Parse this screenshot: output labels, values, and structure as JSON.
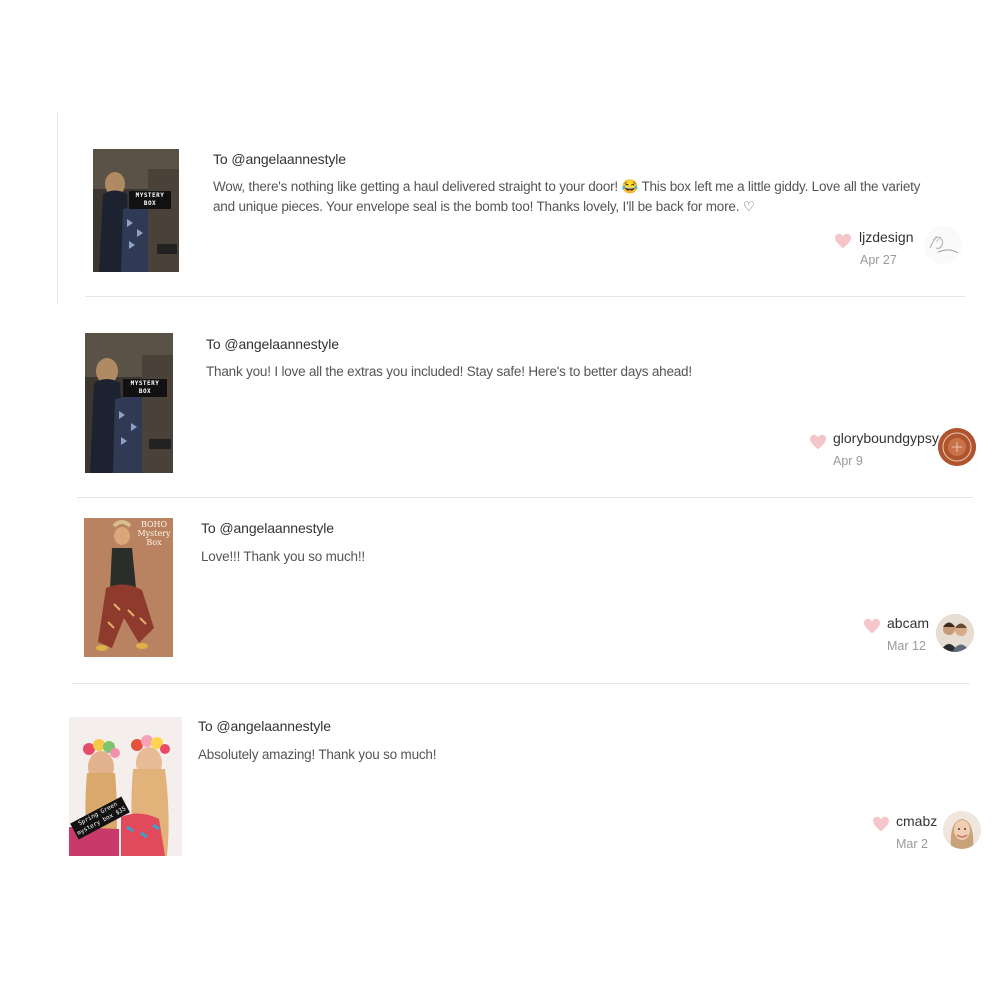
{
  "reviews": [
    {
      "to": "To @angelaannestyle",
      "message": "Wow, there's nothing like getting a haul delivered straight to your door! 😂 This box left me a little giddy. Love all the variety and unique pieces. Your envelope seal is the bomb too! Thanks lovely, I'll be back for more. ♡",
      "username": "ljzdesign",
      "date": "Apr 27",
      "thumb_label": "MYSTERY BOX",
      "thumb_icon": "mystery-box-thumbnail",
      "avatar_icon": "signature-logo-avatar"
    },
    {
      "to": "To @angelaannestyle",
      "message": "Thank you! I love all the extras you included! Stay safe! Here's to better days ahead!",
      "username": "gloryboundgypsy",
      "date": "Apr 9",
      "thumb_label": "MYSTERY BOX",
      "thumb_icon": "mystery-box-thumbnail",
      "avatar_icon": "round-badge-avatar"
    },
    {
      "to": "To @angelaannestyle",
      "message": "Love!!! Thank you so much!!",
      "username": "abcam",
      "date": "Mar 12",
      "thumb_label": "BOHO Mystery Box",
      "thumb_icon": "boho-box-thumbnail",
      "avatar_icon": "couple-photo-avatar"
    },
    {
      "to": "To @angelaannestyle",
      "message": "Absolutely amazing! Thank you so much!",
      "username": "cmabz",
      "date": "Mar 2",
      "thumb_label": "Spring Green mystery box $35",
      "thumb_icon": "flower-crown-thumbnail",
      "avatar_icon": "portrait-avatar"
    }
  ],
  "colors": {
    "heart": "#f4c6c9",
    "divider": "#e6e6e6",
    "date": "#9a9a9a"
  }
}
